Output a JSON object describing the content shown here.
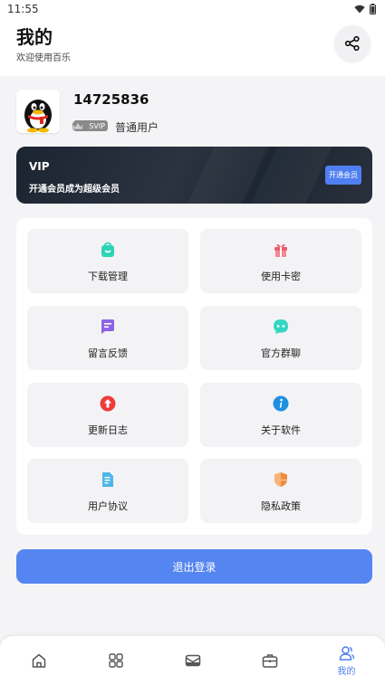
{
  "status_bar": {
    "time": "11:55"
  },
  "header": {
    "title": "我的",
    "subtitle": "欢迎使用百乐"
  },
  "profile": {
    "username": "14725836",
    "badge": "SVIP",
    "level": "普通用户"
  },
  "vip_card": {
    "title": "VIP",
    "description": "开通会员成为超级会员",
    "button": "开通会员"
  },
  "menu": [
    {
      "label": "下载管理",
      "icon": "shopping-bag-icon",
      "color": "#2ed3b7"
    },
    {
      "label": "使用卡密",
      "icon": "gift-icon",
      "color": "#ef5b6e"
    },
    {
      "label": "留言反馈",
      "icon": "message-icon",
      "color": "#8e63e6"
    },
    {
      "label": "官方群聊",
      "icon": "chat-bubble-icon",
      "color": "#33d6c4"
    },
    {
      "label": "更新日志",
      "icon": "update-arrow-icon",
      "color": "#ee3b3b"
    },
    {
      "label": "关于软件",
      "icon": "info-icon",
      "color": "#1f8fe0"
    },
    {
      "label": "用户协议",
      "icon": "document-icon",
      "color": "#4fb6e8"
    },
    {
      "label": "隐私政策",
      "icon": "shield-icon",
      "color": "#f08a3c"
    }
  ],
  "logout": {
    "label": "退出登录"
  },
  "bottom_nav": [
    {
      "icon": "home-icon",
      "label": ""
    },
    {
      "icon": "apps-grid-icon",
      "label": ""
    },
    {
      "icon": "mail-icon",
      "label": ""
    },
    {
      "icon": "briefcase-icon",
      "label": ""
    },
    {
      "icon": "user-icon",
      "label": "我的",
      "active": true
    }
  ],
  "colors": {
    "accent": "#5585f0",
    "vip_bg": "#1f2733"
  }
}
